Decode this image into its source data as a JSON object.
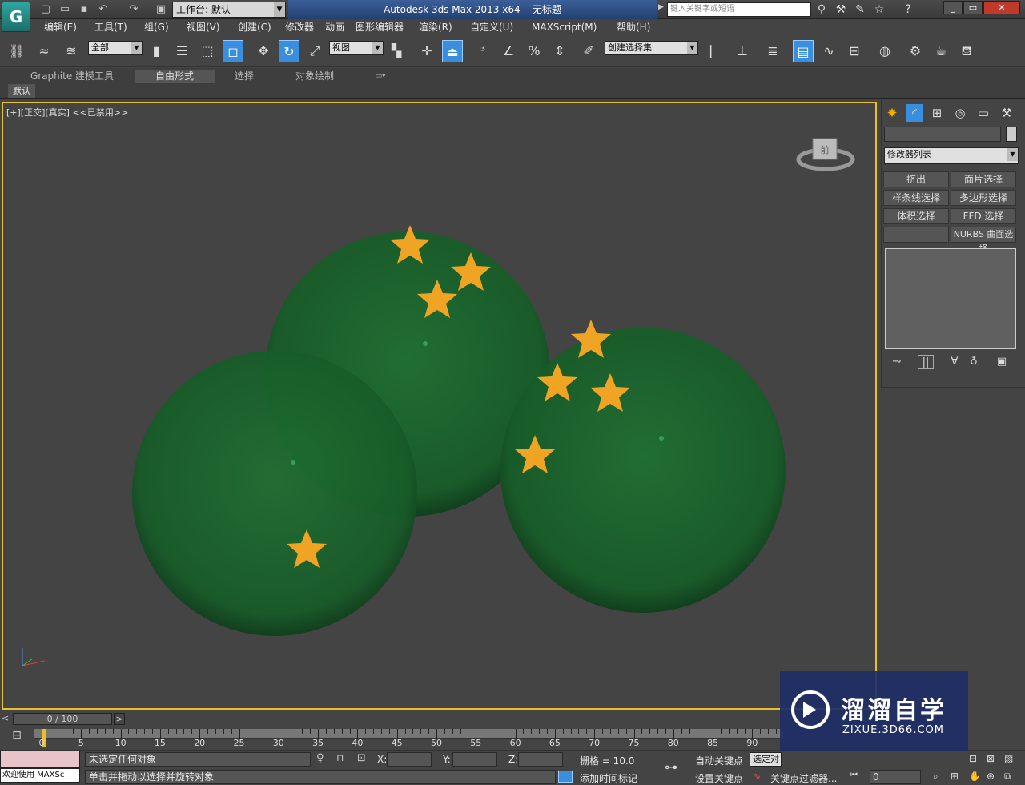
{
  "titlebar": {
    "workspace_label": "工作台: 默认",
    "app_title": "Autodesk 3ds Max  2013 x64",
    "doc_title": "无标题",
    "search_placeholder": "键入关键字或短语"
  },
  "menu": [
    "编辑(E)",
    "工具(T)",
    "组(G)",
    "视图(V)",
    "创建(C)",
    "修改器",
    "动画",
    "图形编辑器",
    "渲染(R)",
    "自定义(U)",
    "MAXScript(M)",
    "帮助(H)"
  ],
  "toolbar": {
    "selection_filter": "全部",
    "ref_coord": "视图",
    "named_selection": "创建选择集"
  },
  "ribbon": {
    "tabs": [
      "Graphite 建模工具",
      "自由形式",
      "选择",
      "对象绘制"
    ],
    "active_tab": "自由形式",
    "sub_tab": "默认"
  },
  "viewport": {
    "label": "[+][正交][真实]",
    "disabled_label": "<<已禁用>>",
    "viewcube_label": "前",
    "sphere_color": "#1e6b2f",
    "star_color": "#f0a424"
  },
  "command_panel": {
    "modifier_list": "修改器列表",
    "buttons": [
      "挤出",
      "面片选择",
      "样条线选择",
      "多边形选择",
      "体积选择",
      "FFD 选择",
      "",
      "NURBS 曲面选择"
    ]
  },
  "timeline": {
    "slider_label": "0 / 100",
    "ticks": [
      "0",
      "5",
      "10",
      "15",
      "20",
      "25",
      "30",
      "35",
      "40",
      "45",
      "50",
      "55",
      "60",
      "65",
      "70",
      "75",
      "80",
      "85",
      "90"
    ]
  },
  "status": {
    "listener": "欢迎使用 MAXSc",
    "selection_status": "未选定任何对象",
    "prompt": "单击并拖动以选择并旋转对象",
    "x_label": "X:",
    "y_label": "Y:",
    "z_label": "Z:",
    "grid": "栅格 = 10.0",
    "auto_key": "自动关键点",
    "set_key": "设置关键点",
    "selected_object": "选定对象",
    "key_filters": "关键点过滤器...",
    "add_time_tag": "添加时间标记",
    "frame": "0"
  },
  "watermark": {
    "cn": "溜溜自学",
    "en": "ZIXUE.3D66.COM"
  }
}
